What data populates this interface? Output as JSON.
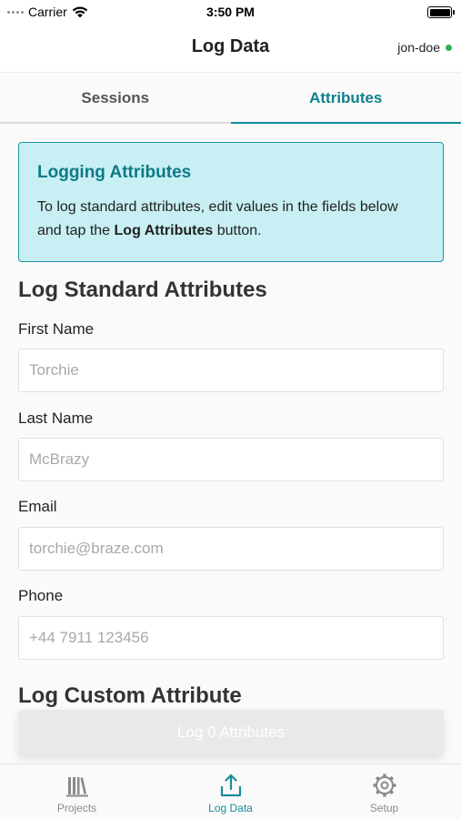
{
  "status_bar": {
    "carrier": "Carrier",
    "time": "3:50 PM"
  },
  "nav": {
    "title": "Log Data",
    "user": "jon-doe",
    "online_color": "#2bb34a"
  },
  "tabs": [
    {
      "label": "Sessions",
      "active": false
    },
    {
      "label": "Attributes",
      "active": true
    }
  ],
  "info": {
    "title": "Logging Attributes",
    "text_before": "To log standard attributes, edit values in the fields below and tap the ",
    "text_bold": "Log Attributes",
    "text_after": " button."
  },
  "standard": {
    "heading": "Log Standard Attributes",
    "fields": [
      {
        "label": "First Name",
        "value": "",
        "placeholder": "Torchie"
      },
      {
        "label": "Last Name",
        "value": "",
        "placeholder": "McBrazy"
      },
      {
        "label": "Email",
        "value": "",
        "placeholder": "torchie@braze.com"
      },
      {
        "label": "Phone",
        "value": "",
        "placeholder": "+44 7911 123456"
      }
    ]
  },
  "custom": {
    "heading": "Log Custom Attribute"
  },
  "log_button": {
    "label": "Log 0 Attributes"
  },
  "tab_bar": [
    {
      "label": "Projects",
      "icon": "books-icon",
      "active": false
    },
    {
      "label": "Log Data",
      "icon": "upload-icon",
      "active": true
    },
    {
      "label": "Setup",
      "icon": "gear-icon",
      "active": false
    }
  ],
  "colors": {
    "accent": "#0f8d99",
    "info_bg": "#c8eff3",
    "info_border": "#1e95a3"
  }
}
